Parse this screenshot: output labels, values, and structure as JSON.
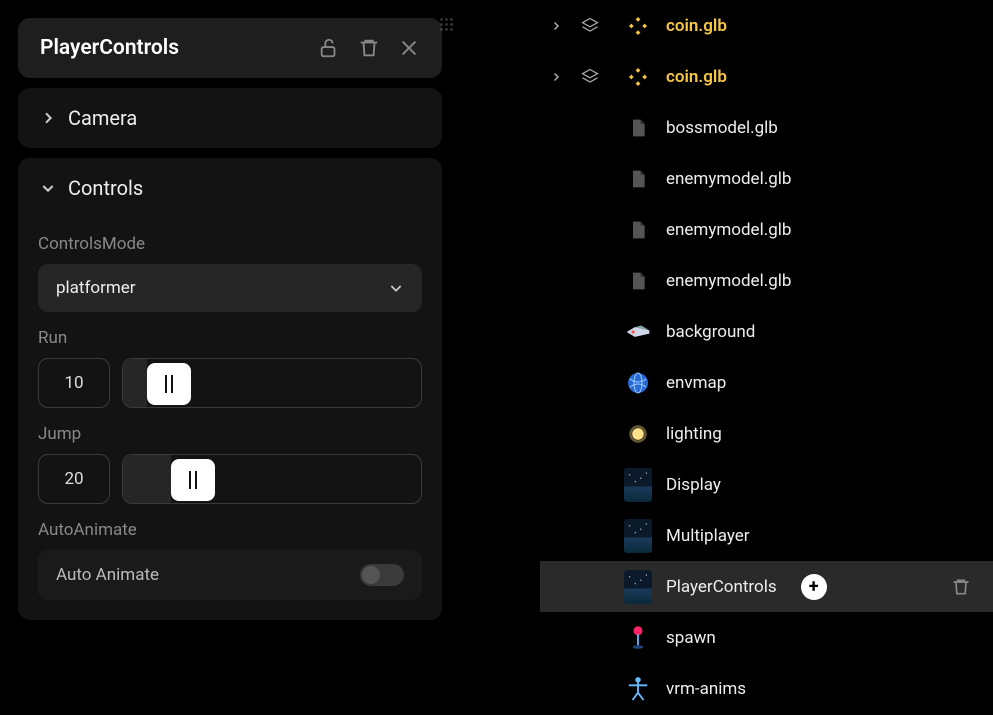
{
  "inspector": {
    "title": "PlayerControls",
    "sections": {
      "camera": {
        "title": "Camera",
        "expanded": false
      },
      "controls": {
        "title": "Controls",
        "expanded": true,
        "controlsMode": {
          "label": "ControlsMode",
          "value": "platformer"
        },
        "run": {
          "label": "Run",
          "value": "10",
          "percent": 8
        },
        "jump": {
          "label": "Jump",
          "value": "20",
          "percent": 16
        },
        "autoAnimate": {
          "label": "AutoAnimate",
          "rowLabel": "Auto Animate",
          "enabled": false
        }
      }
    }
  },
  "hierarchy": [
    {
      "label": "coin.glb",
      "icon": "diamond-gold",
      "gold": true,
      "expandable": true,
      "indent": 1
    },
    {
      "label": "coin.glb",
      "icon": "diamond-gold",
      "gold": true,
      "expandable": true,
      "indent": 1
    },
    {
      "label": "bossmodel.glb",
      "icon": "file",
      "indent": 2
    },
    {
      "label": "enemymodel.glb",
      "icon": "file",
      "indent": 2
    },
    {
      "label": "enemymodel.glb",
      "icon": "file",
      "indent": 2
    },
    {
      "label": "enemymodel.glb",
      "icon": "file",
      "indent": 2
    },
    {
      "label": "background",
      "icon": "ship",
      "indent": 2
    },
    {
      "label": "envmap",
      "icon": "globe",
      "indent": 2
    },
    {
      "label": "lighting",
      "icon": "sun",
      "indent": 2
    },
    {
      "label": "Display",
      "icon": "scene",
      "indent": 2
    },
    {
      "label": "Multiplayer",
      "icon": "scene",
      "indent": 2
    },
    {
      "label": "PlayerControls",
      "icon": "scene",
      "indent": 2,
      "selected": true,
      "plus": true,
      "trash": true
    },
    {
      "label": "spawn",
      "icon": "pin",
      "indent": 2
    },
    {
      "label": "vrm-anims",
      "icon": "rig",
      "indent": 2
    }
  ]
}
